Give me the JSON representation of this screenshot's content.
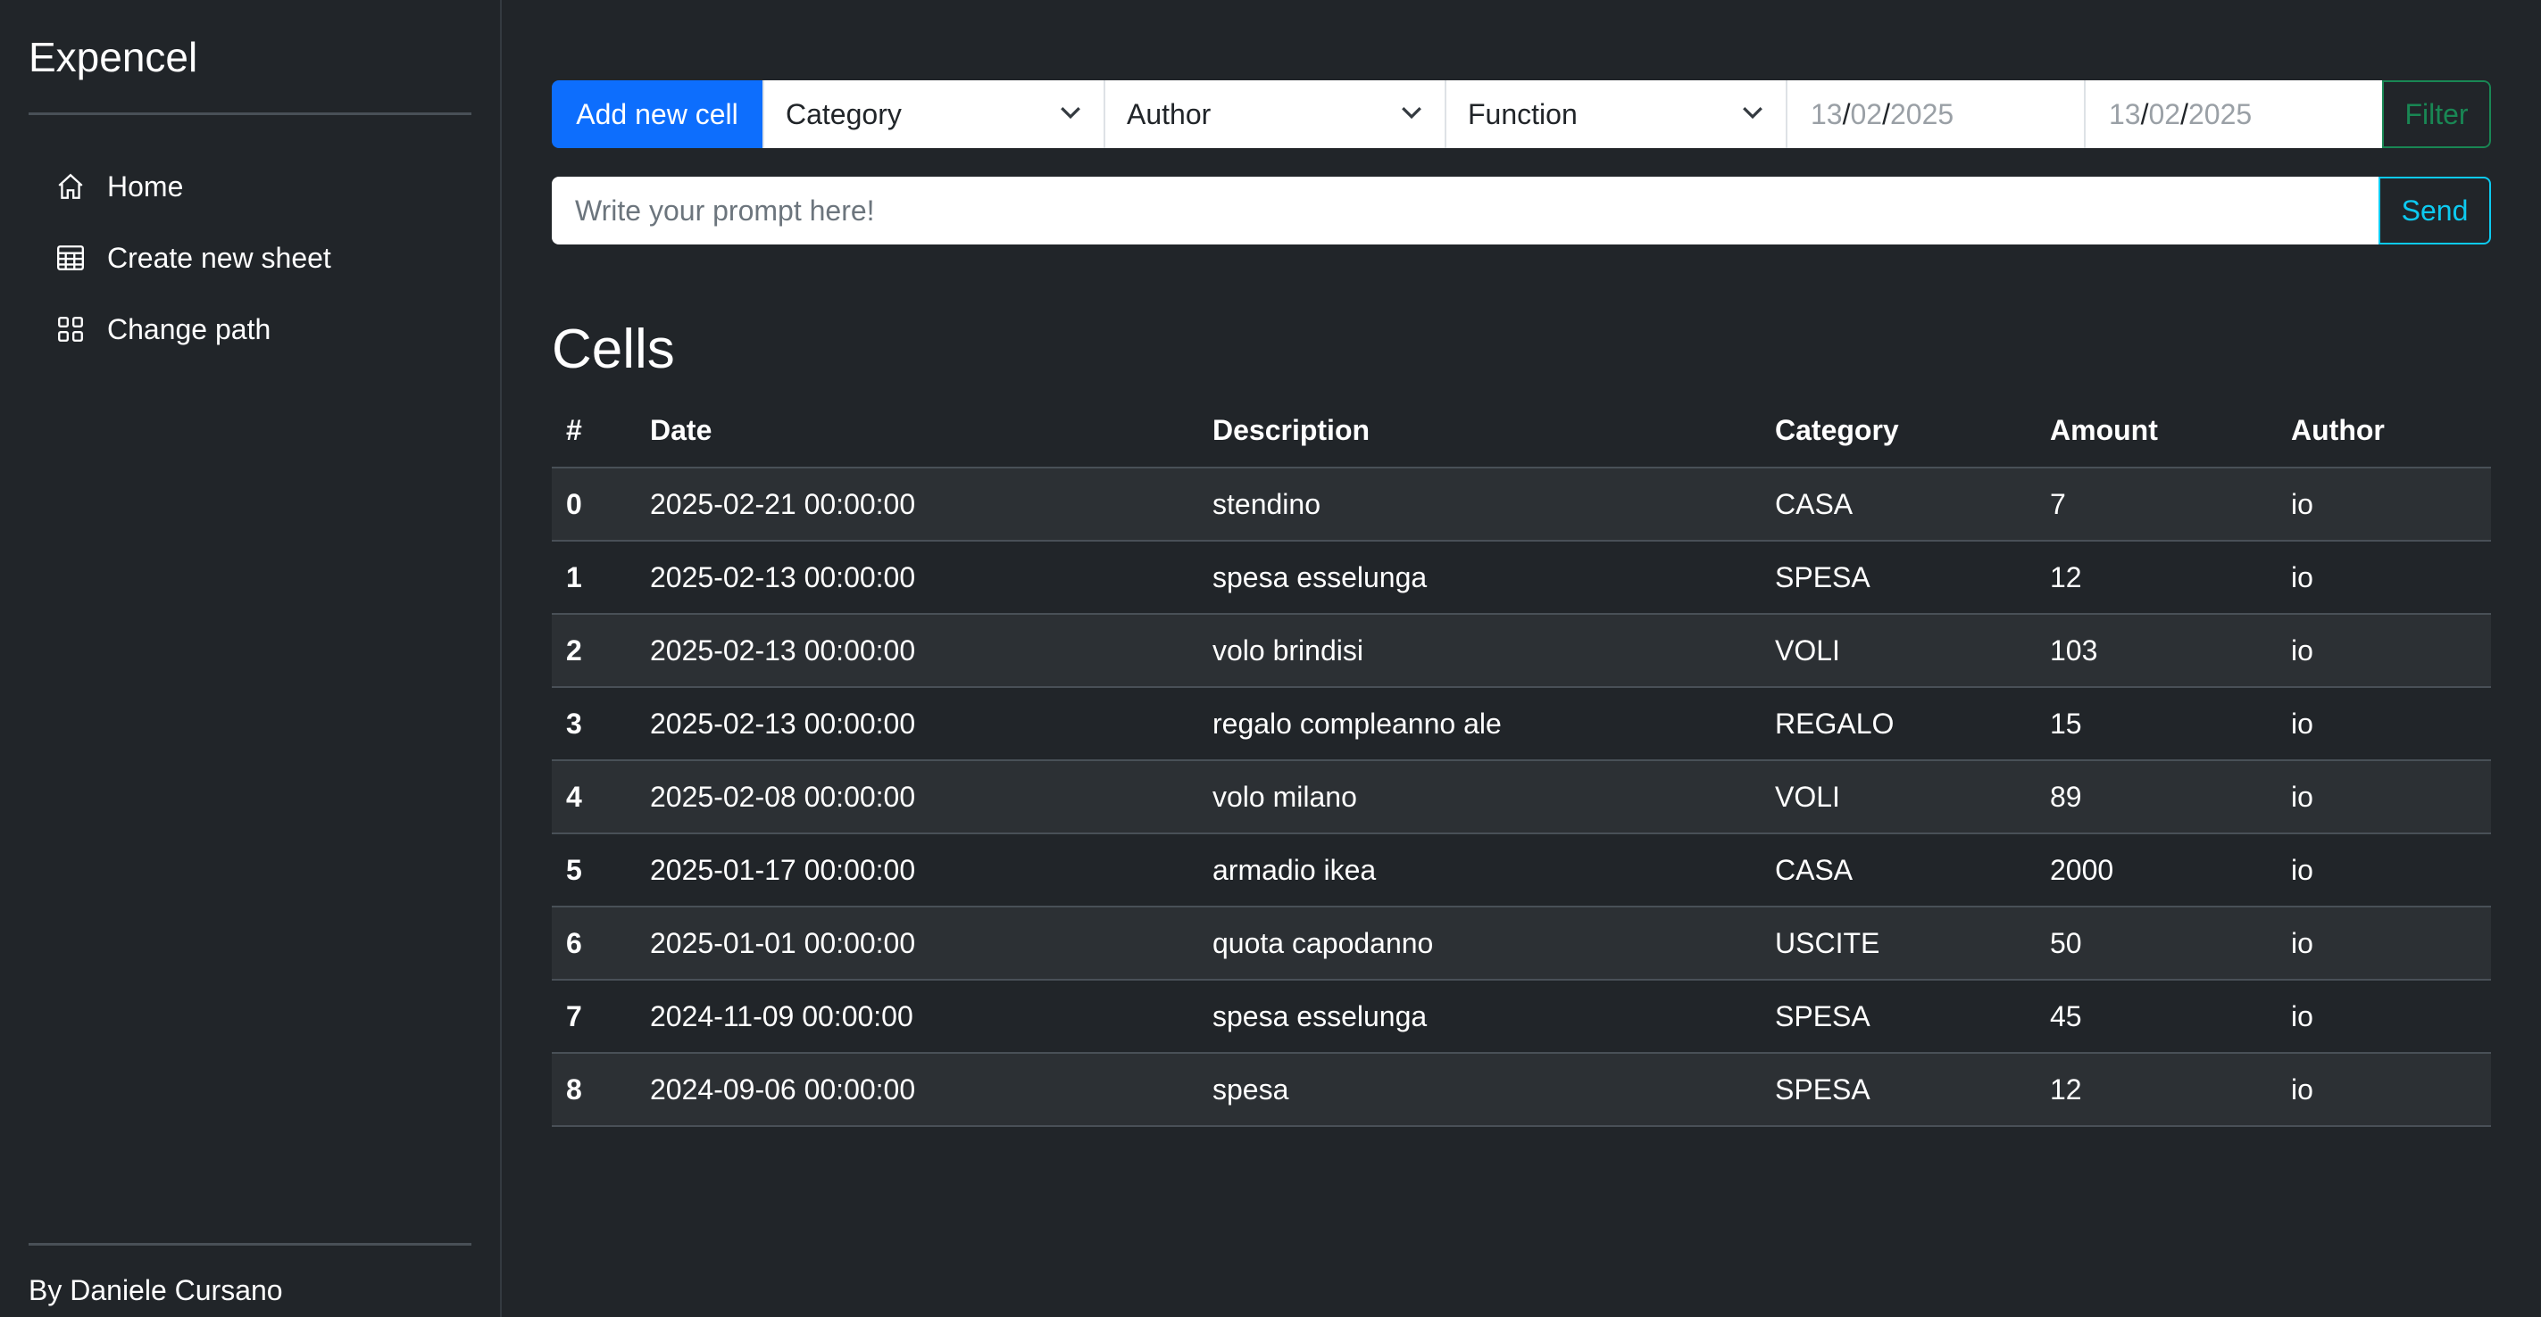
{
  "sidebar": {
    "brand": "Expencel",
    "nav": [
      {
        "label": "Home",
        "icon": "home-icon"
      },
      {
        "label": "Create new sheet",
        "icon": "table-icon"
      },
      {
        "label": "Change path",
        "icon": "grid-icon"
      }
    ],
    "credit": "By Daniele Cursano"
  },
  "toolbar": {
    "add_label": "Add new cell",
    "category": "Category",
    "author": "Author",
    "function": "Function",
    "date_from": {
      "d": "13",
      "m": "02",
      "y": "2025"
    },
    "date_to": {
      "d": "13",
      "m": "02",
      "y": "2025"
    },
    "date_sep": "/",
    "filter_label": "Filter"
  },
  "prompt": {
    "placeholder": "Write your prompt here!",
    "send_label": "Send"
  },
  "table": {
    "title": "Cells",
    "headers": [
      "#",
      "Date",
      "Description",
      "Category",
      "Amount",
      "Author"
    ],
    "rows": [
      [
        "0",
        "2025-02-21 00:00:00",
        "stendino",
        "CASA",
        "7",
        "io"
      ],
      [
        "1",
        "2025-02-13 00:00:00",
        "spesa esselunga",
        "SPESA",
        "12",
        "io"
      ],
      [
        "2",
        "2025-02-13 00:00:00",
        "volo brindisi",
        "VOLI",
        "103",
        "io"
      ],
      [
        "3",
        "2025-02-13 00:00:00",
        "regalo compleanno ale",
        "REGALO",
        "15",
        "io"
      ],
      [
        "4",
        "2025-02-08 00:00:00",
        "volo milano",
        "VOLI",
        "89",
        "io"
      ],
      [
        "5",
        "2025-01-17 00:00:00",
        "armadio ikea",
        "CASA",
        "2000",
        "io"
      ],
      [
        "6",
        "2025-01-01 00:00:00",
        "quota capodanno",
        "USCITE",
        "50",
        "io"
      ],
      [
        "7",
        "2024-11-09 00:00:00",
        "spesa esselunga",
        "SPESA",
        "45",
        "io"
      ],
      [
        "8",
        "2024-09-06 00:00:00",
        "spesa",
        "SPESA",
        "12",
        "io"
      ]
    ]
  }
}
